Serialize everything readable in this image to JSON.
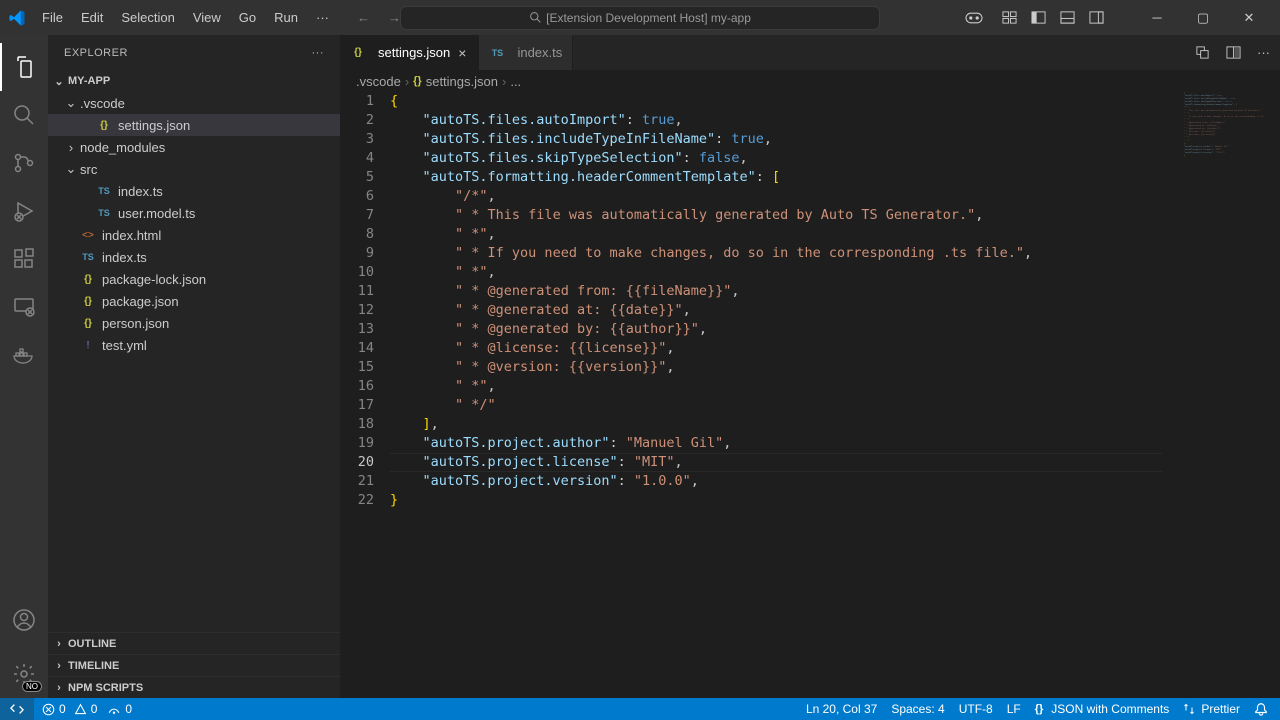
{
  "menu": [
    "File",
    "Edit",
    "Selection",
    "View",
    "Go",
    "Run",
    "···"
  ],
  "search_placeholder": "[Extension Development Host] my-app",
  "sidebar": {
    "header": "EXPLORER",
    "root": "MY-APP",
    "tree": [
      {
        "type": "folder",
        "name": ".vscode",
        "open": true,
        "indent": 0
      },
      {
        "type": "file",
        "name": "settings.json",
        "icon": "json",
        "indent": 1,
        "selected": true
      },
      {
        "type": "folder",
        "name": "node_modules",
        "open": false,
        "indent": 0
      },
      {
        "type": "folder",
        "name": "src",
        "open": true,
        "indent": 0
      },
      {
        "type": "file",
        "name": "index.ts",
        "icon": "ts",
        "indent": 1
      },
      {
        "type": "file",
        "name": "user.model.ts",
        "icon": "ts",
        "indent": 1
      },
      {
        "type": "file",
        "name": "index.html",
        "icon": "html",
        "indent": 0
      },
      {
        "type": "file",
        "name": "index.ts",
        "icon": "ts",
        "indent": 0
      },
      {
        "type": "file",
        "name": "package-lock.json",
        "icon": "json",
        "indent": 0
      },
      {
        "type": "file",
        "name": "package.json",
        "icon": "json",
        "indent": 0
      },
      {
        "type": "file",
        "name": "person.json",
        "icon": "json",
        "indent": 0
      },
      {
        "type": "file",
        "name": "test.yml",
        "icon": "yml",
        "indent": 0
      }
    ],
    "panels": [
      "OUTLINE",
      "TIMELINE",
      "NPM SCRIPTS"
    ]
  },
  "tabs": [
    {
      "label": "settings.json",
      "icon": "json",
      "active": true,
      "close": true
    },
    {
      "label": "index.ts",
      "icon": "ts",
      "active": false,
      "close": false
    }
  ],
  "breadcrumb": [
    ".vscode",
    "settings.json",
    "..."
  ],
  "editor": {
    "current_line": 20,
    "lines": [
      [
        [
          "brace",
          "{"
        ]
      ],
      [
        [
          "punc",
          "    "
        ],
        [
          "key",
          "\"autoTS.files.autoImport\""
        ],
        [
          "punc",
          ": "
        ],
        [
          "bool",
          "true"
        ],
        [
          "punc",
          ","
        ]
      ],
      [
        [
          "punc",
          "    "
        ],
        [
          "key",
          "\"autoTS.files.includeTypeInFileName\""
        ],
        [
          "punc",
          ": "
        ],
        [
          "bool",
          "true"
        ],
        [
          "punc",
          ","
        ]
      ],
      [
        [
          "punc",
          "    "
        ],
        [
          "key",
          "\"autoTS.files.skipTypeSelection\""
        ],
        [
          "punc",
          ": "
        ],
        [
          "bool",
          "false"
        ],
        [
          "punc",
          ","
        ]
      ],
      [
        [
          "punc",
          "    "
        ],
        [
          "key",
          "\"autoTS.formatting.headerCommentTemplate\""
        ],
        [
          "punc",
          ": "
        ],
        [
          "brace",
          "["
        ]
      ],
      [
        [
          "punc",
          "        "
        ],
        [
          "str",
          "\"/*\""
        ],
        [
          "punc",
          ","
        ]
      ],
      [
        [
          "punc",
          "        "
        ],
        [
          "str",
          "\" * This file was automatically generated by Auto TS Generator.\""
        ],
        [
          "punc",
          ","
        ]
      ],
      [
        [
          "punc",
          "        "
        ],
        [
          "str",
          "\" *\""
        ],
        [
          "punc",
          ","
        ]
      ],
      [
        [
          "punc",
          "        "
        ],
        [
          "str",
          "\" * If you need to make changes, do so in the corresponding .ts file.\""
        ],
        [
          "punc",
          ","
        ]
      ],
      [
        [
          "punc",
          "        "
        ],
        [
          "str",
          "\" *\""
        ],
        [
          "punc",
          ","
        ]
      ],
      [
        [
          "punc",
          "        "
        ],
        [
          "str",
          "\" * @generated from: {{fileName}}\""
        ],
        [
          "punc",
          ","
        ]
      ],
      [
        [
          "punc",
          "        "
        ],
        [
          "str",
          "\" * @generated at: {{date}}\""
        ],
        [
          "punc",
          ","
        ]
      ],
      [
        [
          "punc",
          "        "
        ],
        [
          "str",
          "\" * @generated by: {{author}}\""
        ],
        [
          "punc",
          ","
        ]
      ],
      [
        [
          "punc",
          "        "
        ],
        [
          "str",
          "\" * @license: {{license}}\""
        ],
        [
          "punc",
          ","
        ]
      ],
      [
        [
          "punc",
          "        "
        ],
        [
          "str",
          "\" * @version: {{version}}\""
        ],
        [
          "punc",
          ","
        ]
      ],
      [
        [
          "punc",
          "        "
        ],
        [
          "str",
          "\" *\""
        ],
        [
          "punc",
          ","
        ]
      ],
      [
        [
          "punc",
          "        "
        ],
        [
          "str",
          "\" */\""
        ]
      ],
      [
        [
          "punc",
          "    "
        ],
        [
          "brace",
          "]"
        ],
        [
          "punc",
          ","
        ]
      ],
      [
        [
          "punc",
          "    "
        ],
        [
          "key",
          "\"autoTS.project.author\""
        ],
        [
          "punc",
          ": "
        ],
        [
          "str",
          "\"Manuel Gil\""
        ],
        [
          "punc",
          ","
        ]
      ],
      [
        [
          "punc",
          "    "
        ],
        [
          "key",
          "\"autoTS.project.license\""
        ],
        [
          "punc",
          ": "
        ],
        [
          "str",
          "\"MIT\""
        ],
        [
          "punc",
          ","
        ]
      ],
      [
        [
          "punc",
          "    "
        ],
        [
          "key",
          "\"autoTS.project.version\""
        ],
        [
          "punc",
          ": "
        ],
        [
          "str",
          "\"1.0.0\""
        ],
        [
          "punc",
          ","
        ]
      ],
      [
        [
          "brace",
          "}"
        ]
      ]
    ]
  },
  "status": {
    "errors": "0",
    "warnings": "0",
    "ports": "0",
    "position": "Ln 20, Col 37",
    "spaces": "Spaces: 4",
    "encoding": "UTF-8",
    "eol": "LF",
    "lang": "JSON with Comments",
    "prettier": "Prettier",
    "settings_badge": "NO"
  }
}
